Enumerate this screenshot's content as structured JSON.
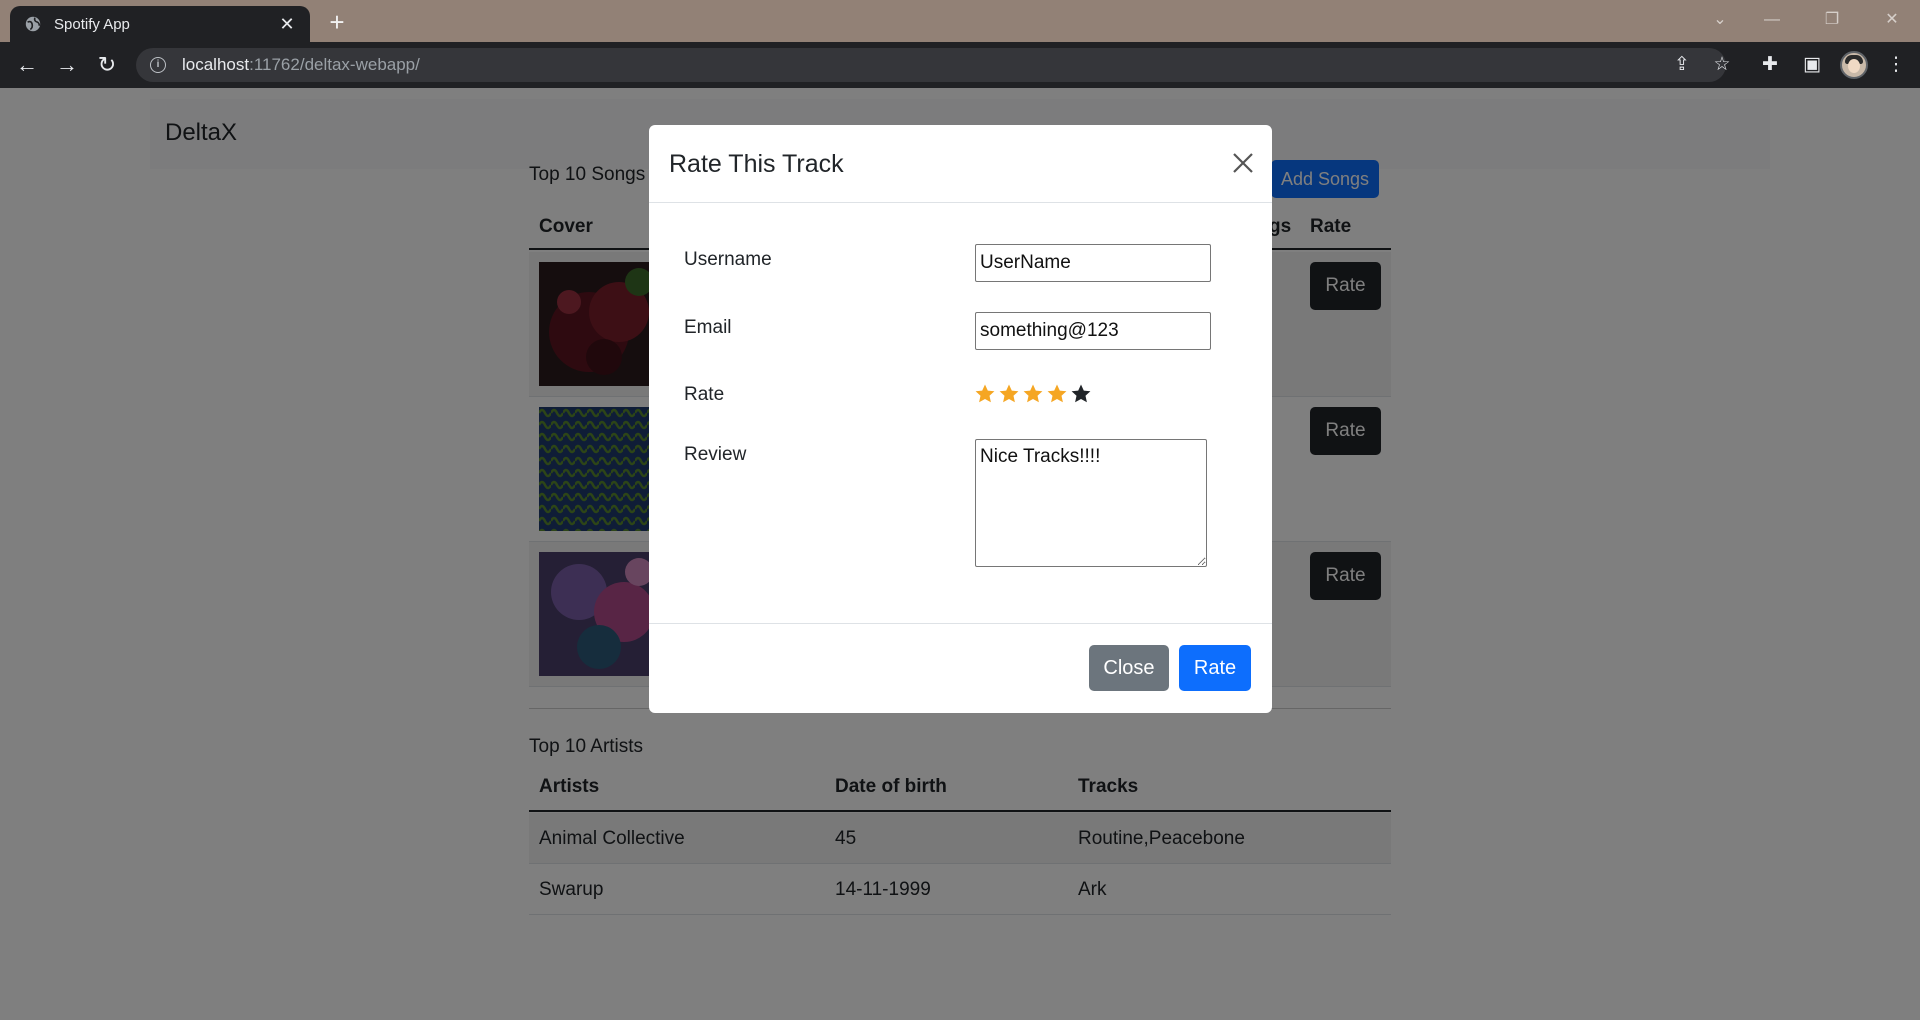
{
  "browser": {
    "tab_title": "Spotify App",
    "url_host": "localhost",
    "url_path": ":11762/deltax-webapp/"
  },
  "page": {
    "brand": "DeltaX",
    "songs": {
      "title": "Top 10 Songs",
      "add_button": "Add Songs",
      "columns": {
        "cover": "Cover",
        "songs_partial": "gs",
        "rate": "Rate"
      },
      "rows": [
        {
          "rate_label": "Rate"
        },
        {
          "rate_label": "Rate"
        },
        {
          "rate_label": "Rate"
        }
      ]
    },
    "artists": {
      "title": "Top 10 Artists",
      "columns": [
        "Artists",
        "Date of birth",
        "Tracks"
      ],
      "rows": [
        [
          "Animal Collective",
          "45",
          "Routine,Peacebone"
        ],
        [
          "Swarup",
          "14-11-1999",
          "Ark"
        ]
      ]
    }
  },
  "modal": {
    "title": "Rate This Track",
    "username_label": "Username",
    "username_value": "UserName",
    "email_label": "Email",
    "email_value": "something@123",
    "rate_label": "Rate",
    "rating": 4,
    "rating_max": 5,
    "review_label": "Review",
    "review_value": "Nice Tracks!!!!",
    "close_button": "Close",
    "submit_button": "Rate",
    "colors": {
      "star_filled": "#f5a623",
      "star_empty": "#212529",
      "primary": "#0d6efd",
      "secondary": "#6c757d"
    }
  }
}
